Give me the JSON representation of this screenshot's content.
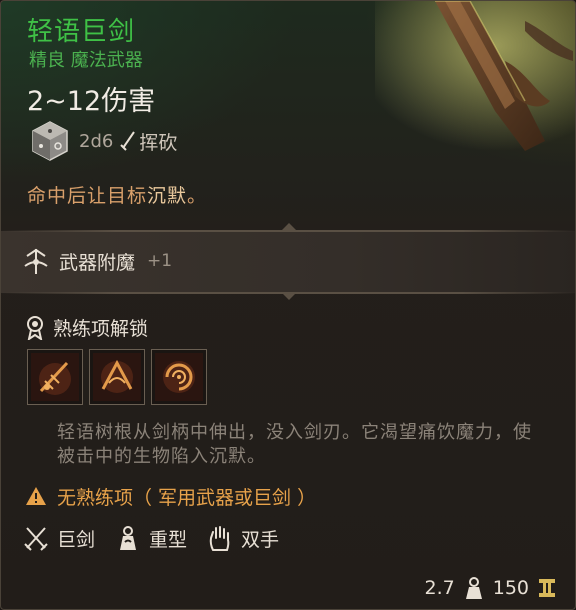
{
  "item": {
    "name": "轻语巨剑",
    "rarity_type": "精良 魔法武器",
    "damage": "2~12伤害",
    "dice": "2d6",
    "damage_type": "挥砍",
    "effect_prefix": "命中后让目标",
    "effect_keyword": "沉默",
    "effect_suffix": "。"
  },
  "enchant": {
    "label": "武器附魔",
    "value": "+1"
  },
  "proficiency": {
    "label": "熟练项解锁",
    "actions": [
      "action-strike",
      "action-cleave",
      "action-whirl"
    ]
  },
  "description": "轻语树根从剑柄中伸出，没入剑刃。它渴望痛饮魔力，使被击中的生物陷入沉默。",
  "warning": "无熟练项（ 军用武器或巨剑 ）",
  "properties": [
    {
      "label": "巨剑",
      "icon": "crossed-swords-icon"
    },
    {
      "label": "重型",
      "icon": "weight-icon"
    },
    {
      "label": "双手",
      "icon": "hand-icon"
    }
  ],
  "footer": {
    "weight": "2.7",
    "value": "150"
  },
  "colors": {
    "title": "#3fc146",
    "subtitle": "#4bb14f",
    "effect": "#d9a06b",
    "warning": "#e7a24a"
  }
}
